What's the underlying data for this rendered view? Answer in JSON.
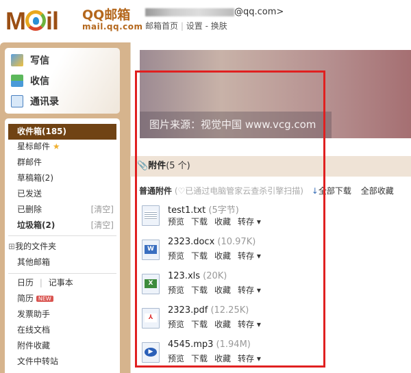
{
  "header": {
    "logo_text": "MOil",
    "brand": "QQ邮箱",
    "brand_url": "mail.qq.com",
    "user_email_suffix": "@qq.com>",
    "links": {
      "home": "邮箱首页",
      "sep1": "|",
      "settings": "设置",
      "sep2": "-",
      "skin": "换肤"
    }
  },
  "actions": [
    {
      "label": "写信",
      "icon": "compose-icon"
    },
    {
      "label": "收信",
      "icon": "inbox-download-icon"
    },
    {
      "label": "通讯录",
      "icon": "contacts-icon"
    }
  ],
  "folders": [
    {
      "label": "收件箱(185)"
    },
    {
      "label": "星标邮件"
    },
    {
      "label": "群邮件"
    },
    {
      "label": "草稿箱(2)"
    },
    {
      "label": "已发送"
    },
    {
      "label": "已删除",
      "action": "[清空]"
    },
    {
      "label": "垃圾箱(2)",
      "action": "[清空]"
    }
  ],
  "my_folders": {
    "toggle": "⊞",
    "label": "我的文件夹"
  },
  "other_mail": "其他邮箱",
  "tools": {
    "calendar": "日历",
    "sep": "|",
    "notes": "记事本",
    "resume": "简历",
    "new_badge": "NEW",
    "invoice": "发票助手",
    "online_docs": "在线文档",
    "attach_fav": "附件收藏",
    "transfer": "文件中转站"
  },
  "banner": {
    "caption": "图片来源：视觉中国 www.vcg.com"
  },
  "attachments": {
    "title": "附件",
    "count": "(5 个)",
    "section": "普通附件",
    "scan_note": "(♡已通过电脑管家云查杀引擎扫描)",
    "download_all": "全部下载",
    "save_all": "全部收藏",
    "ops": {
      "preview": "预览",
      "download": "下载",
      "favorite": "收藏",
      "save_to": "转存 ▾"
    },
    "files": [
      {
        "name": "test1.txt",
        "size": "(5字节)",
        "type": "txt"
      },
      {
        "name": "2323.docx",
        "size": "(10.97K)",
        "type": "docx"
      },
      {
        "name": "123.xls",
        "size": "(20K)",
        "type": "xls"
      },
      {
        "name": "2323.pdf",
        "size": "(12.25K)",
        "type": "pdf"
      },
      {
        "name": "4545.mp3",
        "size": "(1.94M)",
        "type": "mp3"
      }
    ]
  },
  "colors": {
    "frame": "#d6b48d",
    "selected": "#704314",
    "highlight": "#e02020"
  }
}
